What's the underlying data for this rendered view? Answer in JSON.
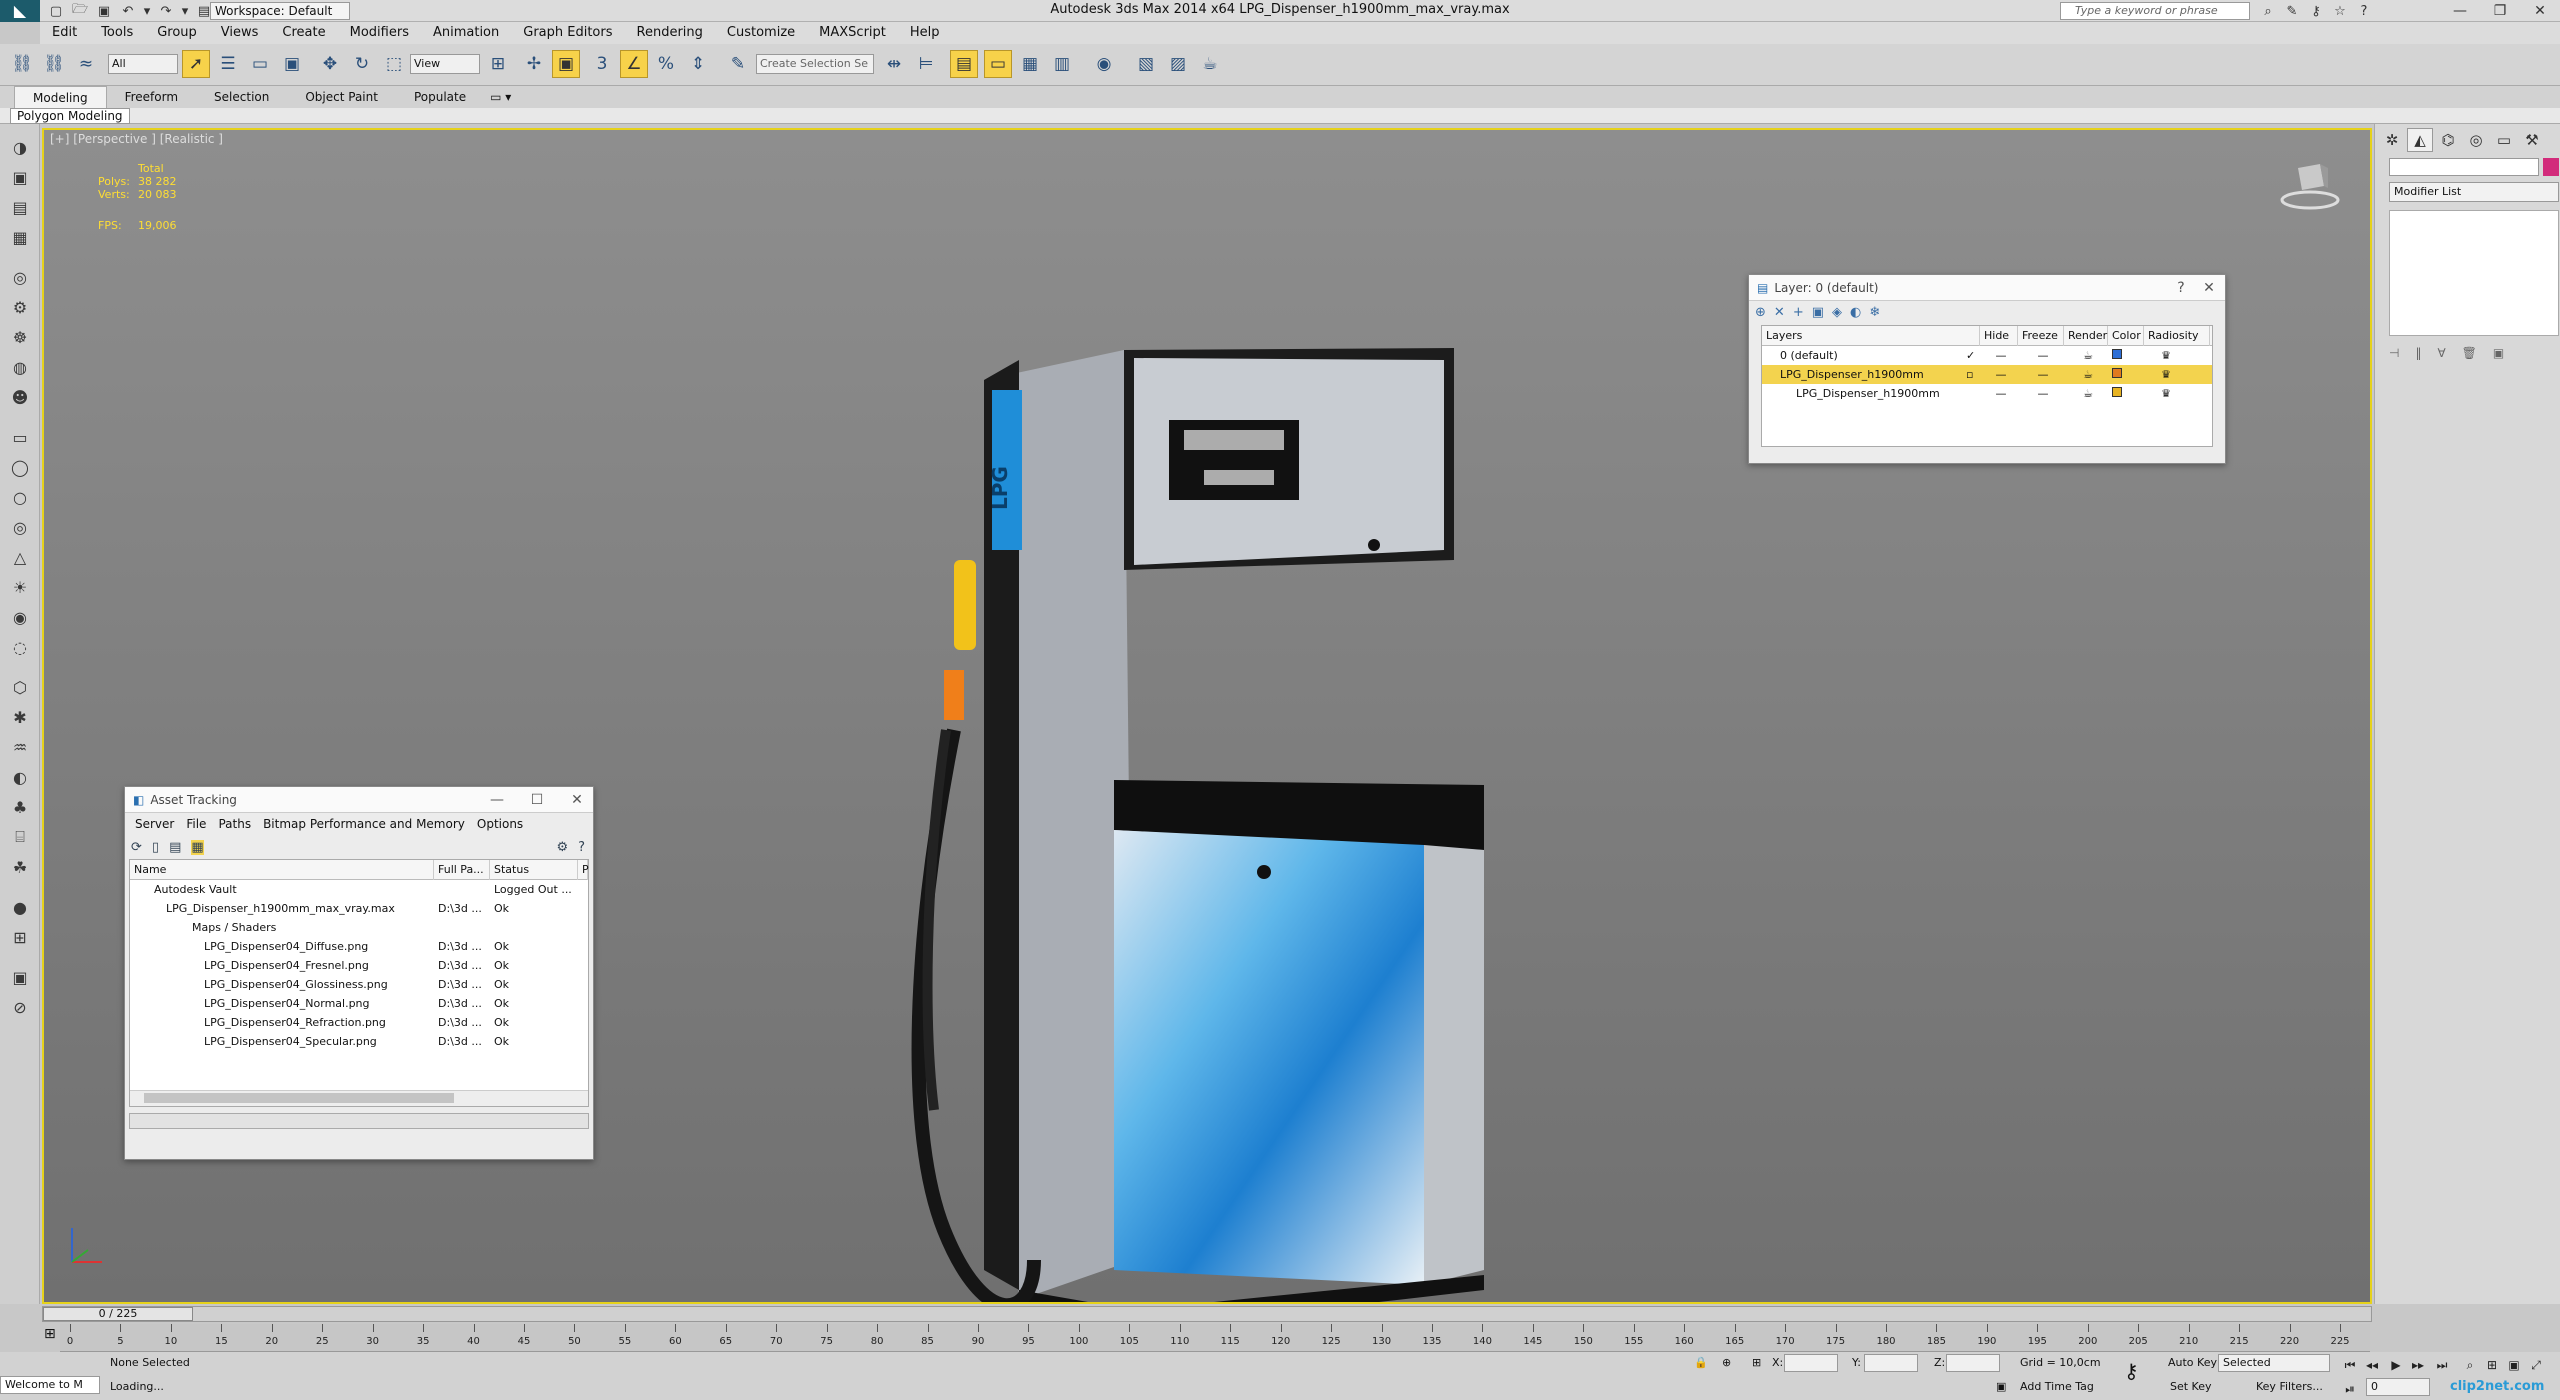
{
  "titlebar": {
    "workspace": "Workspace: Default",
    "window_title": "Autodesk 3ds Max  2014 x64      LPG_Dispenser_h1900mm_max_vray.max",
    "search_placeholder": "Type a keyword or phrase"
  },
  "menu": [
    "Edit",
    "Tools",
    "Group",
    "Views",
    "Create",
    "Modifiers",
    "Animation",
    "Graph Editors",
    "Rendering",
    "Customize",
    "MAXScript",
    "Help"
  ],
  "toolbar": {
    "filter_select": "All",
    "view_select": "View",
    "selection_set": "Create Selection Se"
  },
  "ribbon": {
    "tabs": [
      "Modeling",
      "Freeform",
      "Selection",
      "Object Paint",
      "Populate"
    ],
    "sub_label": "Polygon Modeling"
  },
  "viewport": {
    "label": "[+] [Perspective ] [Realistic ]",
    "stats": {
      "total": "Total",
      "polys_label": "Polys:",
      "polys": "38 282",
      "verts_label": "Verts:",
      "verts": "20 083",
      "fps_label": "FPS:",
      "fps": "19,006"
    },
    "model_label": "LPG"
  },
  "layer_panel": {
    "title": "Layer: 0 (default)",
    "headers": [
      "Layers",
      "Hide",
      "Freeze",
      "Render",
      "Color",
      "Radiosity"
    ],
    "rows": [
      {
        "name": "0 (default)",
        "color": "#2e6fd6"
      },
      {
        "name": "LPG_Dispenser_h1900mm",
        "color": "#e07a1e"
      },
      {
        "name": "LPG_Dispenser_h1900mm",
        "color": "#e8b422"
      }
    ]
  },
  "asset_panel": {
    "title": "Asset Tracking",
    "menu": [
      "Server",
      "File",
      "Paths",
      "Bitmap Performance and Memory",
      "Options"
    ],
    "headers": [
      "Name",
      "Full Pa...",
      "Status",
      "P"
    ],
    "rows": [
      {
        "name": "Autodesk Vault",
        "path": "",
        "status": "Logged Out ..."
      },
      {
        "name": "LPG_Dispenser_h1900mm_max_vray.max",
        "path": "D:\\3d ...",
        "status": "Ok"
      },
      {
        "name": "Maps / Shaders",
        "path": "",
        "status": ""
      },
      {
        "name": "LPG_Dispenser04_Diffuse.png",
        "path": "D:\\3d ...",
        "status": "Ok"
      },
      {
        "name": "LPG_Dispenser04_Fresnel.png",
        "path": "D:\\3d ...",
        "status": "Ok"
      },
      {
        "name": "LPG_Dispenser04_Glossiness.png",
        "path": "D:\\3d ...",
        "status": "Ok"
      },
      {
        "name": "LPG_Dispenser04_Normal.png",
        "path": "D:\\3d ...",
        "status": "Ok"
      },
      {
        "name": "LPG_Dispenser04_Refraction.png",
        "path": "D:\\3d ...",
        "status": "Ok"
      },
      {
        "name": "LPG_Dispenser04_Specular.png",
        "path": "D:\\3d ...",
        "status": "Ok"
      }
    ]
  },
  "command_panel": {
    "modifier_list": "Modifier List"
  },
  "timeline": {
    "frame": "0 / 225",
    "ticks": [
      "0",
      "5",
      "10",
      "15",
      "20",
      "25",
      "30",
      "35",
      "40",
      "45",
      "50",
      "55",
      "60",
      "65",
      "70",
      "75",
      "80",
      "85",
      "90",
      "95",
      "100",
      "105",
      "110",
      "115",
      "120",
      "125",
      "130",
      "135",
      "140",
      "145",
      "150",
      "155",
      "160",
      "165",
      "170",
      "175",
      "180",
      "185",
      "190",
      "195",
      "200",
      "205",
      "210",
      "215",
      "220",
      "225"
    ]
  },
  "status": {
    "welcome": "Welcome to M",
    "selection": "None Selected",
    "loading": "Loading...",
    "x_label": "X:",
    "y_label": "Y:",
    "z_label": "Z:",
    "grid": "Grid = 10,0cm",
    "add_time_tag": "Add Time Tag",
    "auto_key": "Auto Key",
    "selected": "Selected",
    "set_key": "Set Key",
    "key_filters": "Key Filters...",
    "frame_field": "0",
    "watermark": "clip2net.com"
  }
}
